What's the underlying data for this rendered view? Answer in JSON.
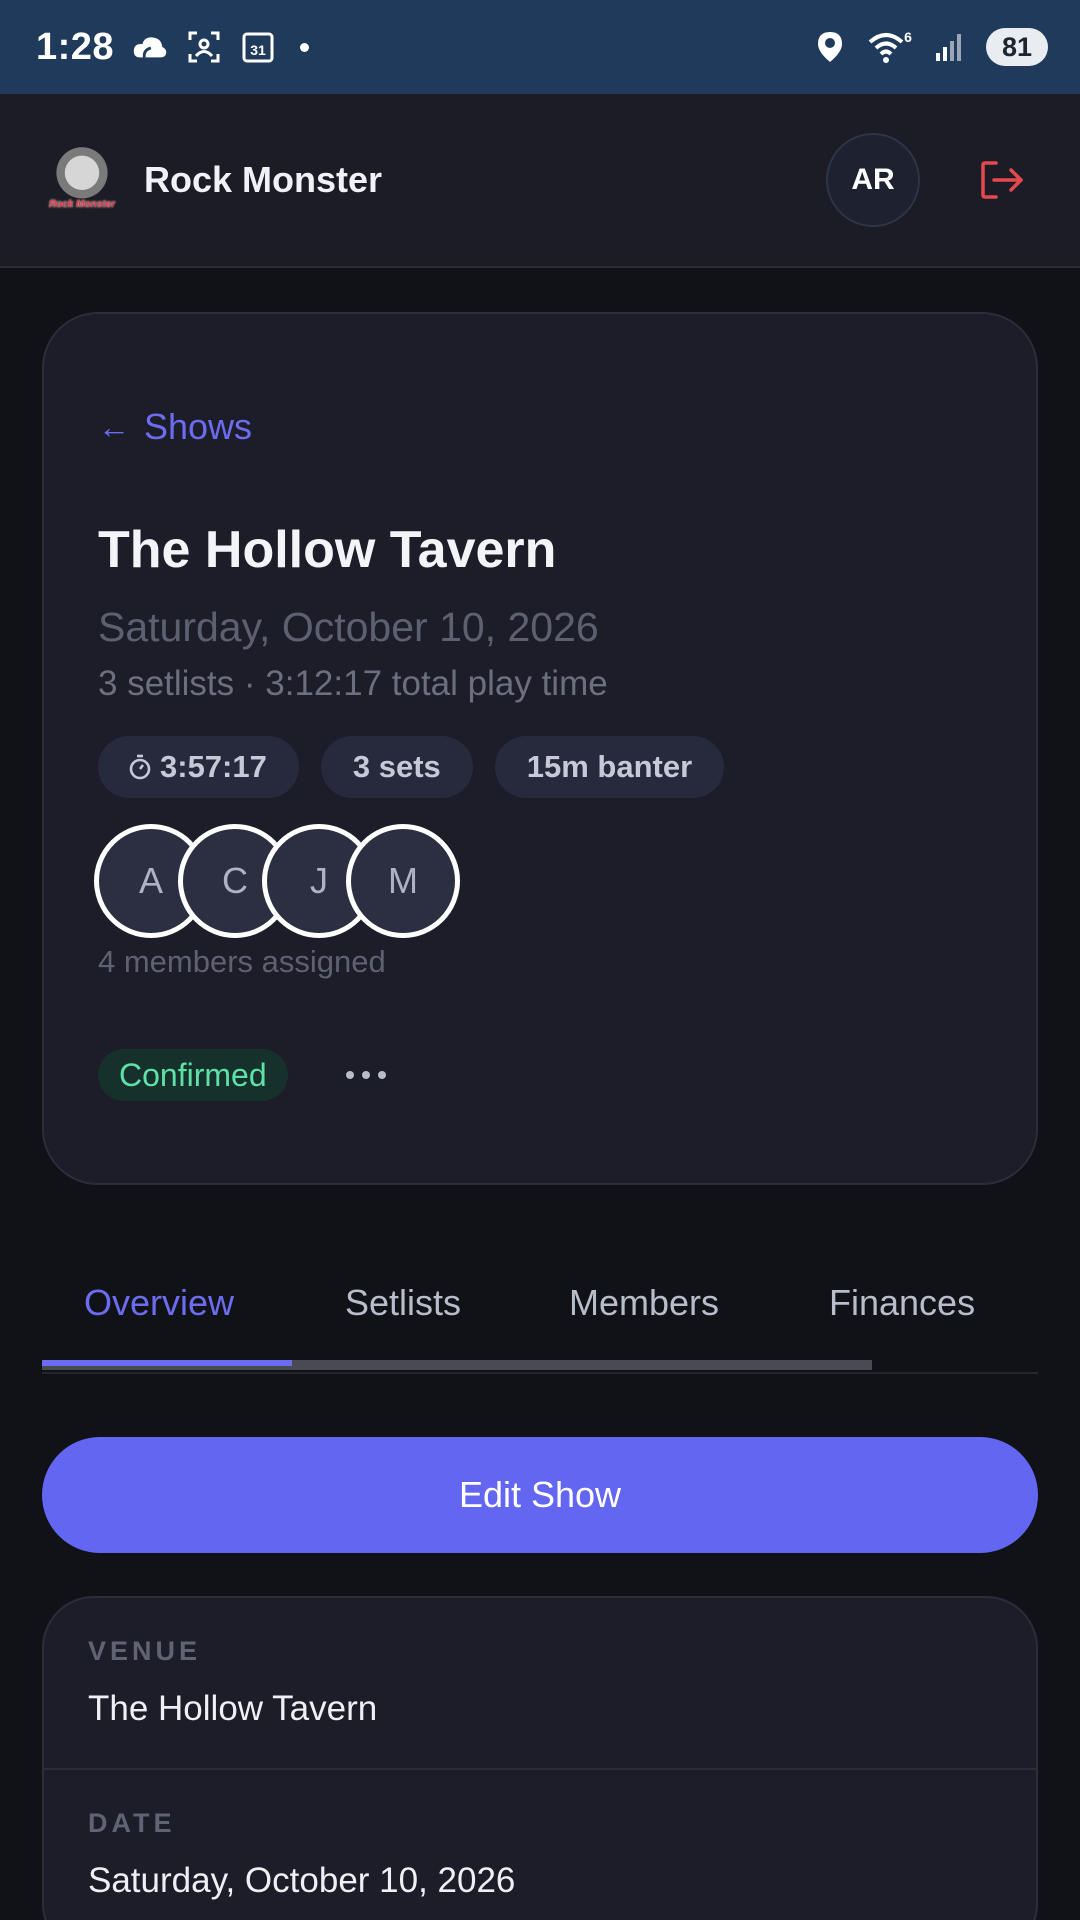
{
  "status_bar": {
    "time": "1:28",
    "icons": [
      "cloud-icon",
      "screenshot-icon",
      "calendar-icon",
      "notification-dot",
      "location-icon",
      "wifi-icon",
      "signal-icon"
    ],
    "wifi_badge": "6",
    "calendar_day": "31",
    "battery": "81"
  },
  "header": {
    "logo_text": "Rock Monster",
    "brand": "Rock Monster",
    "avatar_initials": "AR"
  },
  "show": {
    "back_label": "Shows",
    "title": "The Hollow Tavern",
    "date": "Saturday, October 10, 2026",
    "summary": "3 setlists · 3:12:17 total play time",
    "chips": {
      "duration": "3:57:17",
      "sets": "3 sets",
      "banter": "15m banter"
    },
    "members": [
      "A",
      "C",
      "J",
      "M"
    ],
    "members_note": "4 members assigned",
    "status": "Confirmed"
  },
  "tabs": [
    {
      "label": "Overview",
      "active": true
    },
    {
      "label": "Setlists",
      "active": false
    },
    {
      "label": "Members",
      "active": false
    },
    {
      "label": "Finances",
      "active": false
    }
  ],
  "edit_button": "Edit Show",
  "details": [
    {
      "label": "VENUE",
      "value": "The Hollow Tavern"
    },
    {
      "label": "DATE",
      "value": "Saturday, October 10, 2026"
    }
  ],
  "colors": {
    "accent": "#6366f1",
    "status_green": "#5ee0a8",
    "logout_red": "#e5484d",
    "status_bar_bg": "#203a5c"
  }
}
